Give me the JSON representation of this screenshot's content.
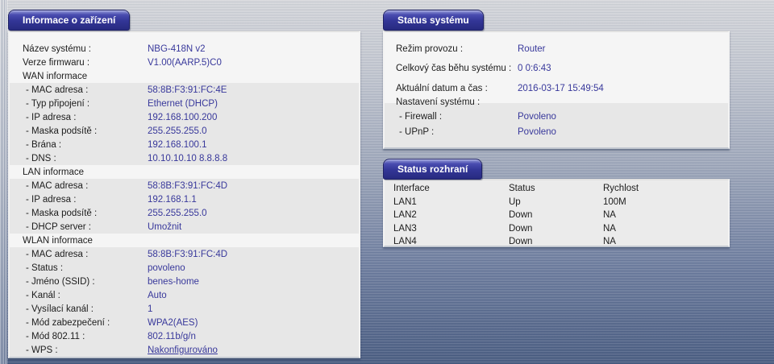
{
  "colors": {
    "value_text": "#38389b",
    "tab_blue": "#323596",
    "band_gray": "#e7e7e7"
  },
  "panels": {
    "device_info": {
      "title": "Informace o zařízení",
      "rows": [
        {
          "label": "Název systému :",
          "value": "NBG-418N v2"
        },
        {
          "label": "Verze firmwaru :",
          "value": "V1.00(AARP.5)C0"
        },
        {
          "label": "WAN informace"
        },
        {
          "label": "- MAC adresa :",
          "value": "58:8B:F3:91:FC:4E"
        },
        {
          "label": "- Typ připojení :",
          "value": "Ethernet (DHCP)"
        },
        {
          "label": "- IP adresa :",
          "value": "192.168.100.200"
        },
        {
          "label": "- Maska podsítě :",
          "value": "255.255.255.0"
        },
        {
          "label": "- Brána :",
          "value": "192.168.100.1"
        },
        {
          "label": "- DNS :",
          "value": "10.10.10.10 8.8.8.8"
        },
        {
          "label": "LAN informace"
        },
        {
          "label": "- MAC adresa :",
          "value": "58:8B:F3:91:FC:4D"
        },
        {
          "label": "- IP adresa :",
          "value": "192.168.1.1"
        },
        {
          "label": "- Maska podsítě :",
          "value": "255.255.255.0"
        },
        {
          "label": "- DHCP server :",
          "value": "Umožnit"
        },
        {
          "label": "WLAN informace"
        },
        {
          "label": "- MAC adresa :",
          "value": "58:8B:F3:91:FC:4D"
        },
        {
          "label": "- Status :",
          "value": "povoleno"
        },
        {
          "label": "- Jméno (SSID) :",
          "value": "benes-home"
        },
        {
          "label": "- Kanál :",
          "value": "Auto"
        },
        {
          "label": "- Vysílací kanál :",
          "value": "1"
        },
        {
          "label": "- Mód zabezpečení :",
          "value": "WPA2(AES)"
        },
        {
          "label": "- Mód 802.11 :",
          "value": "802.11b/g/n"
        },
        {
          "label": "- WPS :",
          "value": "Nakonfigurováno"
        }
      ]
    },
    "system_status": {
      "title": "Status systému",
      "rows": [
        {
          "label": "Režim provozu :",
          "value": "Router"
        },
        {
          "label": "Celkový čas běhu systému :",
          "value": "0 0:6:43"
        },
        {
          "label": "Aktuální datum a čas :",
          "value": "2016-03-17 15:49:54"
        },
        {
          "label": "Nastavení systému :"
        },
        {
          "label": "- Firewall :",
          "value": "Povoleno"
        },
        {
          "label": "- UPnP :",
          "value": "Povoleno"
        }
      ]
    },
    "interface_status": {
      "title": "Status rozhraní",
      "table": {
        "headers": [
          "Interface",
          "Status",
          "Rychlost"
        ],
        "rows": [
          [
            "LAN1",
            "Up",
            "100M"
          ],
          [
            "LAN2",
            "Down",
            "NA"
          ],
          [
            "LAN3",
            "Down",
            "NA"
          ],
          [
            "LAN4",
            "Down",
            "NA"
          ]
        ]
      }
    }
  }
}
